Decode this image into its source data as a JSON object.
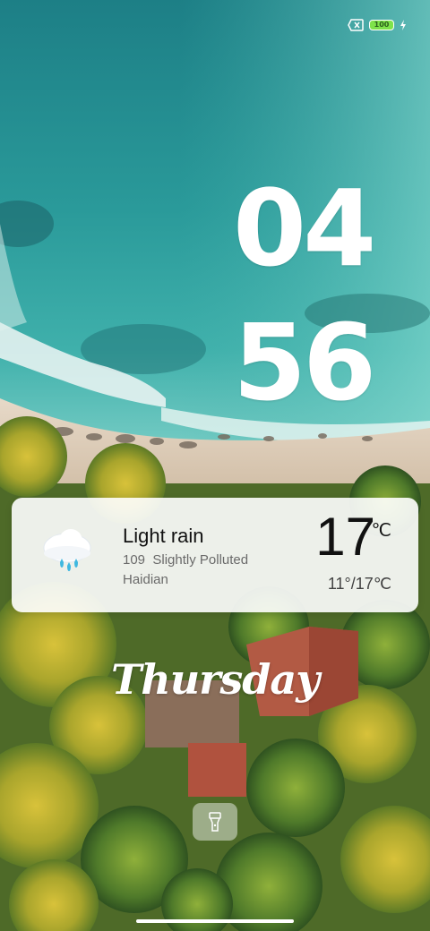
{
  "status_bar": {
    "sim_icon": "no-sim-icon",
    "battery_level": "100",
    "battery_color": "#7ee34a",
    "charging_icon": "lightning-bolt-icon"
  },
  "clock": {
    "hours": "04",
    "minutes": "56"
  },
  "weather": {
    "icon": "rain-cloud-icon",
    "condition": "Light rain",
    "aqi_value": "109",
    "aqi_label": "Slightly Polluted",
    "location": "Haidian",
    "temperature": "17",
    "unit": "℃",
    "range": "11°/17℃"
  },
  "day_of_week": "Thursday",
  "camera_shortcut": {
    "icon": "flashlight-icon"
  },
  "home_indicator": {
    "color": "#ffffff"
  }
}
